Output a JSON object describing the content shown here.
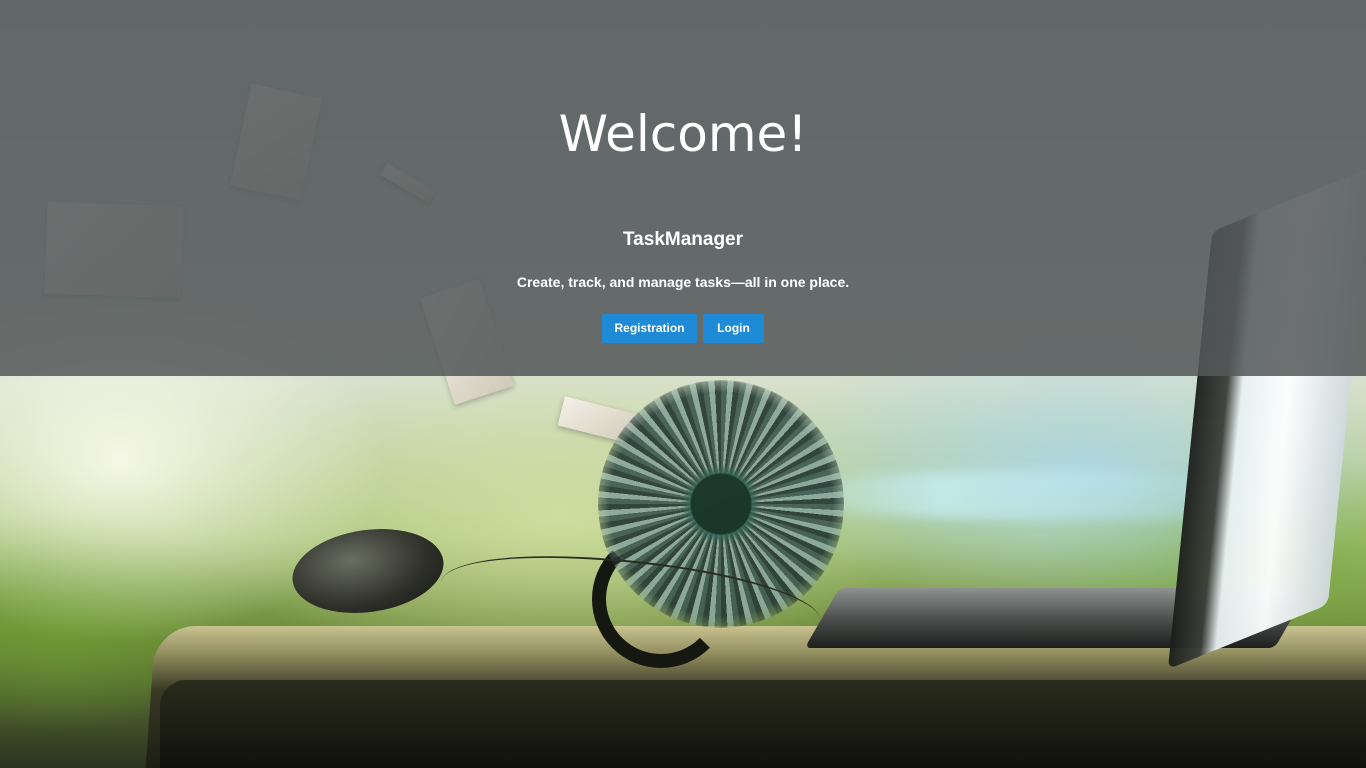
{
  "hero": {
    "title": "Welcome!",
    "app_name": "TaskManager",
    "tagline": "Create, track, and manage tasks—all in one place."
  },
  "actions": {
    "registration_label": "Registration",
    "login_label": "Login"
  },
  "colors": {
    "overlay": "#54585a",
    "button": "#1f8ad6",
    "text": "#ffffff"
  }
}
